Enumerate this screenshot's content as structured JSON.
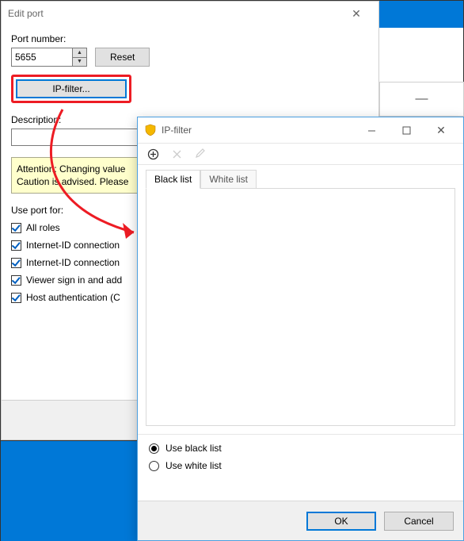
{
  "edit_port": {
    "title": "Edit port",
    "port_label": "Port number:",
    "port_value": "5655",
    "reset_label": "Reset",
    "ipfilter_button": "IP-filter...",
    "description_label": "Description:",
    "description_value": "",
    "warning_line1": "Attention: Changing value",
    "warning_line2": "Caution is advised. Please",
    "use_port_label": "Use port for:",
    "checks": [
      {
        "label": "All roles",
        "checked": true
      },
      {
        "label": "Internet-ID connection",
        "checked": true
      },
      {
        "label": "Internet-ID connection",
        "checked": true
      },
      {
        "label": "Viewer sign in and add",
        "checked": true
      },
      {
        "label": "Host authentication (C",
        "checked": true
      }
    ]
  },
  "bg_minimize": "—",
  "ip_filter": {
    "title": "IP-filter",
    "tabs": {
      "black": "Black list",
      "white": "White list"
    },
    "radios": {
      "black": "Use black list",
      "white": "Use white list"
    },
    "selected_radio": "black",
    "ok": "OK",
    "cancel": "Cancel"
  }
}
